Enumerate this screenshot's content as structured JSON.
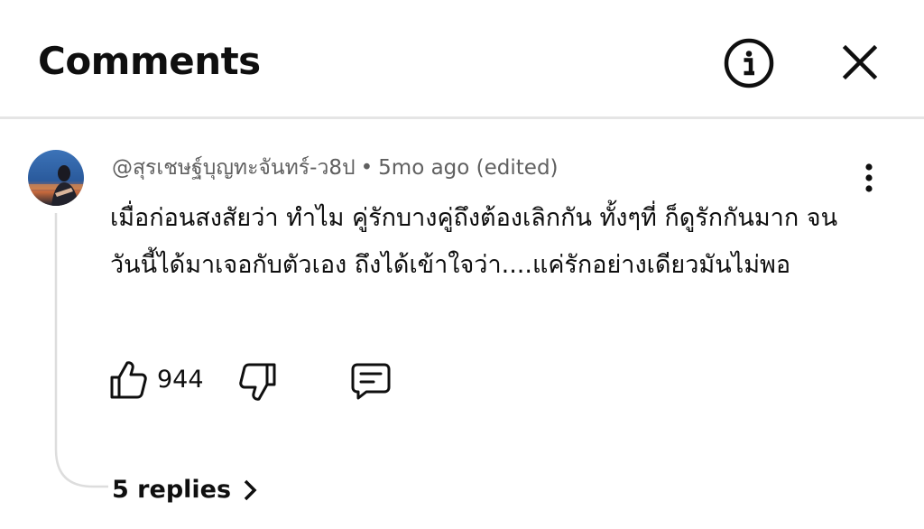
{
  "header": {
    "title": "Comments",
    "info_icon": "info-icon",
    "close_icon": "close-icon"
  },
  "comment": {
    "author": "@สุรเชษฐ์บุญทะจันทร์-ว8ป",
    "separator": "•",
    "time": "5mo ago (edited)",
    "text": "เมื่อก่อนสงสัยว่า ทำไม คู่รักบางคู่ถึงต้องเลิกกัน ทั้งๆที่ ก็ดูรักกันมาก จนวันนี้ได้มาเจอกับตัวเอง ถึงได้เข้าใจว่า....แค่รักอย่างเดียวมันไม่พอ",
    "likes": "944",
    "more_icon": "more-vertical-icon"
  },
  "replies": {
    "label": "5 replies",
    "icon": "chevron-right-icon"
  },
  "colors": {
    "text": "#0f0f0f",
    "secondary": "#606060",
    "divider": "#e5e5e5"
  }
}
